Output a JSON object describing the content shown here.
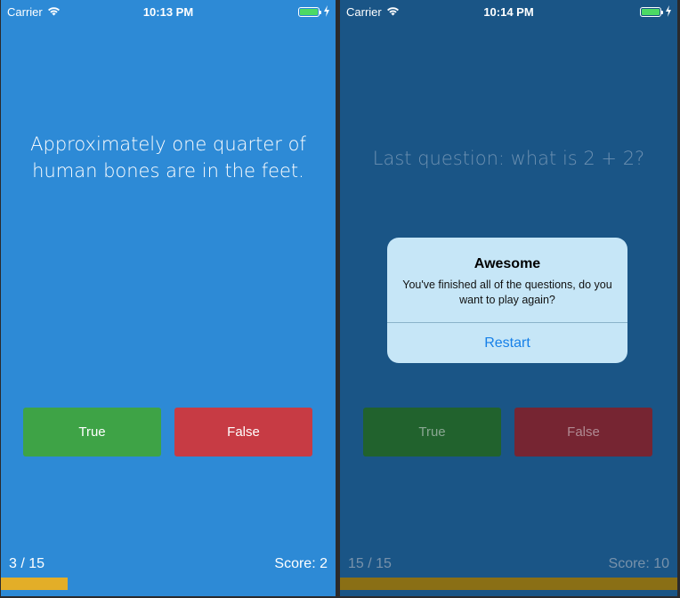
{
  "screens": [
    {
      "status": {
        "carrier": "Carrier",
        "time": "10:13 PM"
      },
      "question": "Approximately one quarter of human bones are in the feet.",
      "buttons": {
        "true_label": "True",
        "false_label": "False"
      },
      "progress": {
        "text": "3 / 15",
        "fraction": 0.2
      },
      "score": "Score: 2"
    },
    {
      "status": {
        "carrier": "Carrier",
        "time": "10:14 PM"
      },
      "question": "Last question: what is 2 + 2?",
      "buttons": {
        "true_label": "True",
        "false_label": "False"
      },
      "progress": {
        "text": "15 / 15",
        "fraction": 1.0
      },
      "score": "Score: 10",
      "alert": {
        "title": "Awesome",
        "message": "You've finished all of the questions, do you want to play again?",
        "button_label": "Restart"
      }
    }
  ],
  "colors": {
    "left_background": "#2d8ad6",
    "right_background": "#1a5586",
    "true_button": "#3ea346",
    "false_button": "#c73b44",
    "progress_bar": "#e3ae28",
    "battery_charging": "#4cd964",
    "alert_action": "#1780e8"
  },
  "icons": [
    "wifi-icon",
    "battery-icon",
    "charging-bolt-icon"
  ]
}
